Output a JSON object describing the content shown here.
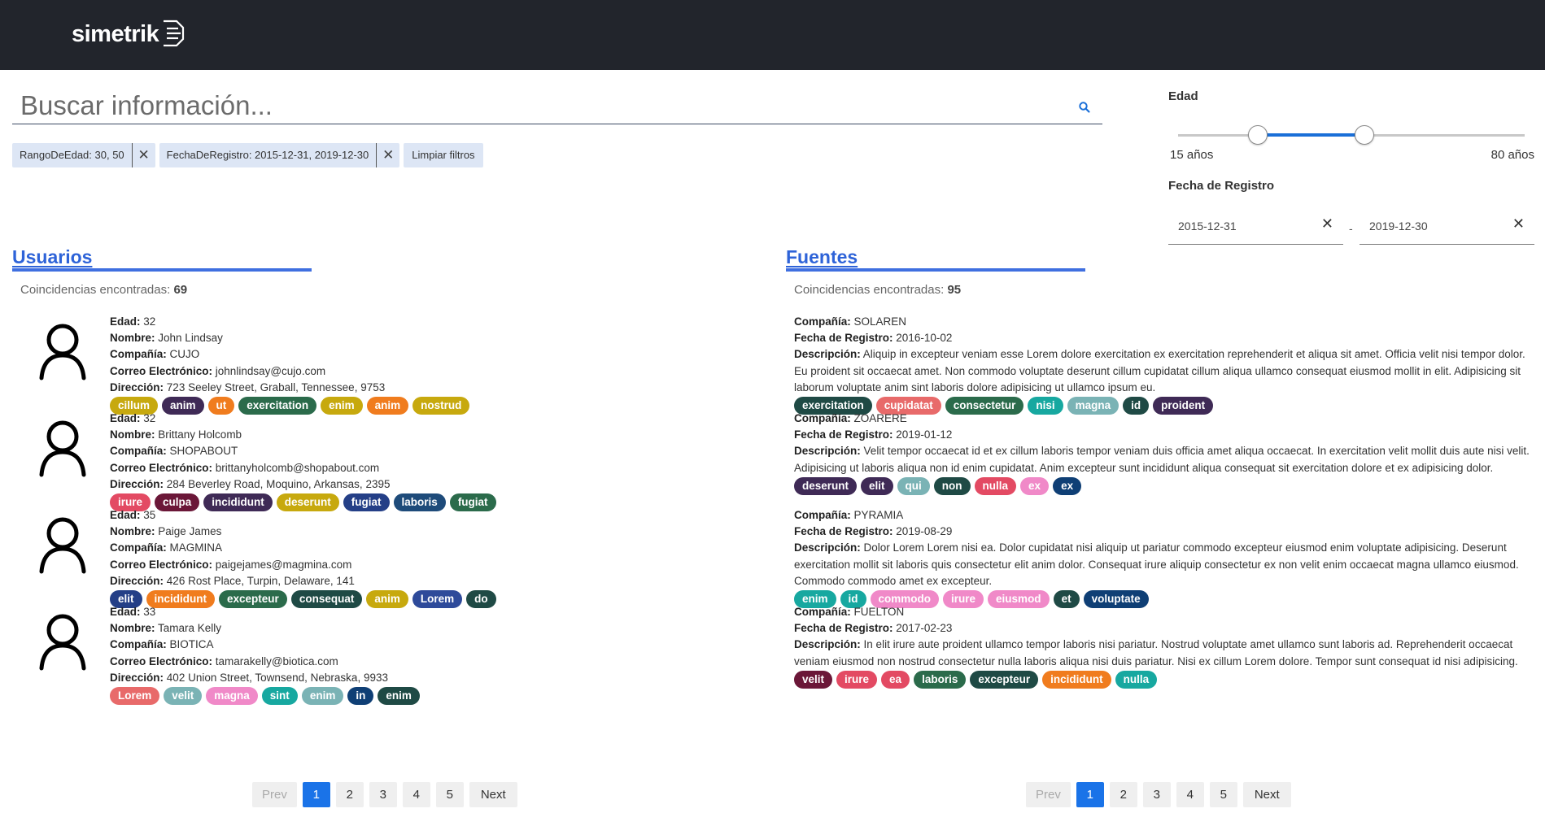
{
  "header": {
    "logo_text": "simetrik"
  },
  "search": {
    "placeholder": "Buscar información..."
  },
  "active_filters": [
    {
      "label": "RangoDeEdad: 30, 50"
    },
    {
      "label": "FechaDeRegistro: 2015-12-31, 2019-12-30"
    }
  ],
  "clear_filters_label": "Limpiar filtros",
  "filters": {
    "age_title": "Edad",
    "age_min_label": "15 años",
    "age_max_label": "80 años",
    "age_range_min": 15,
    "age_range_max": 80,
    "age_low": 30,
    "age_high": 50,
    "date_title": "Fecha de Registro",
    "date_from": "2015-12-31",
    "date_to": "2019-12-30",
    "date_separator": "-"
  },
  "users": {
    "title": "Usuarios",
    "count_label": "Coincidencias encontradas:",
    "count": "69",
    "field_labels": {
      "age": "Edad:",
      "name": "Nombre:",
      "company": "Compañía:",
      "email": "Correo Electrónico:",
      "address": "Dirección:"
    },
    "items": [
      {
        "age": "32",
        "name": "John Lindsay",
        "company": "CUJO",
        "email": "johnlindsay@cujo.com",
        "address": "723 Seeley Street, Graball, Tennessee, 9753",
        "tags": [
          {
            "text": "cillum",
            "color": "#c7a90e"
          },
          {
            "text": "anim",
            "color": "#3f2a56"
          },
          {
            "text": "ut",
            "color": "#f07c1e"
          },
          {
            "text": "exercitation",
            "color": "#2b6b4b"
          },
          {
            "text": "enim",
            "color": "#c7a90e"
          },
          {
            "text": "anim",
            "color": "#f07c1e"
          },
          {
            "text": "nostrud",
            "color": "#c7a90e"
          }
        ]
      },
      {
        "age": "32",
        "name": "Brittany Holcomb",
        "company": "SHOPABOUT",
        "email": "brittanyholcomb@shopabout.com",
        "address": "284 Beverley Road, Moquino, Arkansas, 2395",
        "tags": [
          {
            "text": "irure",
            "color": "#e34a63"
          },
          {
            "text": "culpa",
            "color": "#6b1738"
          },
          {
            "text": "incididunt",
            "color": "#3f2a56"
          },
          {
            "text": "deserunt",
            "color": "#c7a90e"
          },
          {
            "text": "fugiat",
            "color": "#243f87"
          },
          {
            "text": "laboris",
            "color": "#1e4b7a"
          },
          {
            "text": "fugiat",
            "color": "#2b6b4b"
          }
        ]
      },
      {
        "age": "35",
        "name": "Paige James",
        "company": "MAGMINA",
        "email": "paigejames@magmina.com",
        "address": "426 Rost Place, Turpin, Delaware, 141",
        "tags": [
          {
            "text": "elit",
            "color": "#243f87"
          },
          {
            "text": "incididunt",
            "color": "#f07c1e"
          },
          {
            "text": "excepteur",
            "color": "#2b6b4b"
          },
          {
            "text": "consequat",
            "color": "#1f4a45"
          },
          {
            "text": "anim",
            "color": "#c7a90e"
          },
          {
            "text": "Lorem",
            "color": "#2e4a9a"
          },
          {
            "text": "do",
            "color": "#1f4a45"
          }
        ]
      },
      {
        "age": "33",
        "name": "Tamara Kelly",
        "company": "BIOTICA",
        "email": "tamarakelly@biotica.com",
        "address": "402 Union Street, Townsend, Nebraska, 9933",
        "tags": [
          {
            "text": "Lorem",
            "color": "#e86a6a"
          },
          {
            "text": "velit",
            "color": "#7ab3b5"
          },
          {
            "text": "magna",
            "color": "#f089c8"
          },
          {
            "text": "sint",
            "color": "#17a8a0"
          },
          {
            "text": "enim",
            "color": "#7ab3b5"
          },
          {
            "text": "in",
            "color": "#0f3f75"
          },
          {
            "text": "enim",
            "color": "#1f4a45"
          }
        ]
      }
    ]
  },
  "sources": {
    "title": "Fuentes",
    "count_label": "Coincidencias encontradas:",
    "count": "95",
    "field_labels": {
      "company": "Compañía:",
      "date": "Fecha de Registro:",
      "description": "Descripción:"
    },
    "items": [
      {
        "company": "SOLAREN",
        "date": "2016-10-02",
        "description": "Aliquip in excepteur veniam esse Lorem dolore exercitation ex exercitation reprehenderit et aliqua sit amet. Officia velit nisi tempor dolor. Eu proident sit occaecat amet. Non commodo voluptate deserunt cillum cupidatat cillum aliqua ullamco consequat eiusmod mollit in elit. Adipisicing sit laborum voluptate anim sint laboris dolore adipisicing ut ullamco ipsum eu.",
        "tags": [
          {
            "text": "exercitation",
            "color": "#1f4a45"
          },
          {
            "text": "cupidatat",
            "color": "#e86a6a"
          },
          {
            "text": "consectetur",
            "color": "#2b6b4b"
          },
          {
            "text": "nisi",
            "color": "#17a8a0"
          },
          {
            "text": "magna",
            "color": "#7ab3b5"
          },
          {
            "text": "id",
            "color": "#1f4a45"
          },
          {
            "text": "proident",
            "color": "#3f2a56"
          }
        ]
      },
      {
        "company": "ZOARERE",
        "date": "2019-01-12",
        "description": "Velit tempor occaecat id et ex cillum laboris tempor veniam duis officia amet aliqua occaecat. In exercitation velit mollit duis aute nisi velit. Adipisicing ut laboris aliqua non id enim cupidatat. Anim excepteur sunt incididunt aliqua consequat sit exercitation dolore et ex adipisicing dolor.",
        "tags": [
          {
            "text": "deserunt",
            "color": "#3f2a56"
          },
          {
            "text": "elit",
            "color": "#3f2a56"
          },
          {
            "text": "qui",
            "color": "#7ab3b5"
          },
          {
            "text": "non",
            "color": "#1f4a45"
          },
          {
            "text": "nulla",
            "color": "#e34a63"
          },
          {
            "text": "ex",
            "color": "#f089c8"
          },
          {
            "text": "ex",
            "color": "#0f3f75"
          }
        ]
      },
      {
        "company": "PYRAMIA",
        "date": "2019-08-29",
        "description": "Dolor Lorem Lorem nisi ea. Dolor cupidatat nisi aliquip ut pariatur commodo excepteur eiusmod enim voluptate adipisicing. Deserunt exercitation mollit sit laboris quis consectetur elit anim dolor. Consequat irure aliquip consectetur ex non velit enim occaecat magna ullamco eiusmod. Commodo commodo amet ex excepteur.",
        "tags": [
          {
            "text": "enim",
            "color": "#17a8a0"
          },
          {
            "text": "id",
            "color": "#17a8a0"
          },
          {
            "text": "commodo",
            "color": "#f089c8"
          },
          {
            "text": "irure",
            "color": "#f089c8"
          },
          {
            "text": "eiusmod",
            "color": "#f089c8"
          },
          {
            "text": "et",
            "color": "#1f4a45"
          },
          {
            "text": "voluptate",
            "color": "#0f3f75"
          }
        ]
      },
      {
        "company": "FUELTON",
        "date": "2017-02-23",
        "description": "In elit irure aute proident ullamco tempor laboris nisi pariatur. Nostrud voluptate amet ullamco sunt laboris ad. Reprehenderit occaecat veniam eiusmod non nostrud consectetur nulla laboris aliqua nisi duis pariatur. Nisi ex cillum Lorem dolore. Tempor sunt consequat id nisi adipisicing.",
        "tags": [
          {
            "text": "velit",
            "color": "#6b1738"
          },
          {
            "text": "irure",
            "color": "#e34a63"
          },
          {
            "text": "ea",
            "color": "#e34a63"
          },
          {
            "text": "laboris",
            "color": "#2b6b4b"
          },
          {
            "text": "excepteur",
            "color": "#1f4a45"
          },
          {
            "text": "incididunt",
            "color": "#f07c1e"
          },
          {
            "text": "nulla",
            "color": "#17a8a0"
          }
        ]
      }
    ]
  },
  "pagination": {
    "prev_label": "Prev",
    "next_label": "Next",
    "pages": [
      "1",
      "2",
      "3",
      "4",
      "5"
    ],
    "current": "1"
  },
  "colors": {
    "accent": "#2e63d8",
    "topbar": "#22252c",
    "slider": "#1a6fd8",
    "chip_bg": "#dde6f5"
  }
}
